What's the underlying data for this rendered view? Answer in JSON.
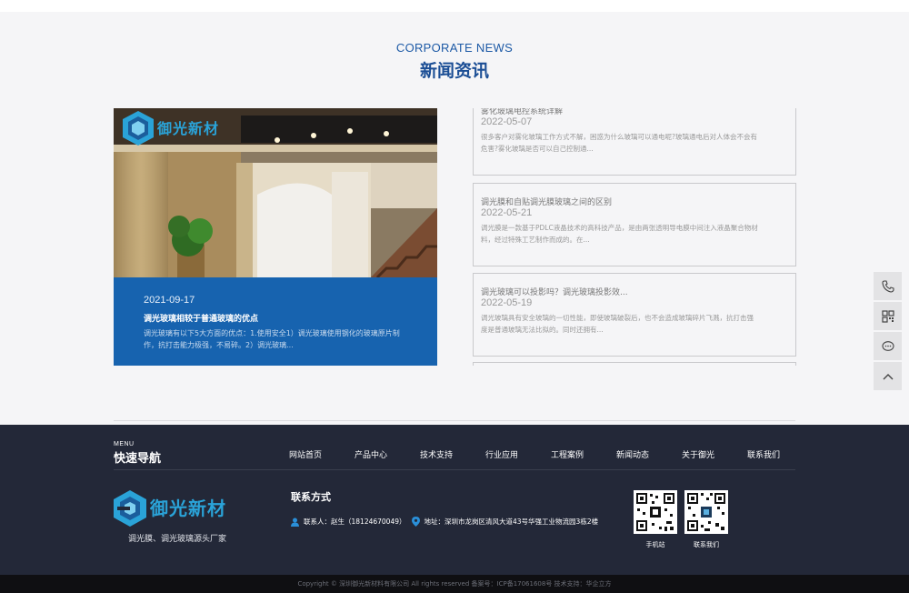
{
  "section": {
    "title_en": "CORPORATE NEWS",
    "title_zh": "新闻资讯"
  },
  "feature": {
    "date": "2021-09-17",
    "title": "调光玻璃相较于普通玻璃的优点",
    "desc": "调光玻璃有以下5大方面的优点：1.使用安全1）调光玻璃使用钢化的玻璃原片制作，抗打击能力极强，不易碎。2）调光玻璃...",
    "image_logo_text": "御光新材"
  },
  "news": [
    {
      "title": "雾化玻璃电控系统详解",
      "date": "2022-05-07",
      "desc": "很多客户对雾化玻璃工作方式不解，困惑为什么玻璃可以通电呢?玻璃通电后对人体会不会有危害?雾化玻璃是否可以自己控制通..."
    },
    {
      "title": "调光膜和自贴调光膜玻璃之间的区别",
      "date": "2022-05-21",
      "desc": "调光膜是一款基于PDLC液晶技术的高科技产品，是由两张透明导电膜中间注入液晶聚合物材料，经过特殊工艺制作而成的。在..."
    },
    {
      "title": "调光玻璃可以投影吗？调光玻璃投影效...",
      "date": "2022-05-19",
      "desc": "调光玻璃具有安全玻璃的一切性能，即使玻璃破裂后，也不会造成玻璃碎片飞溅，抗打击强度是普通玻璃无法比拟的。同时还拥有..."
    }
  ],
  "side_tools": [
    "phone-icon",
    "qrcode-icon",
    "chat-icon",
    "back-to-top-icon"
  ],
  "footer": {
    "menu_en": "MENU",
    "menu_zh": "快速导航",
    "nav": [
      "网站首页",
      "产品中心",
      "技术支持",
      "行业应用",
      "工程案例",
      "新闻动态",
      "关于御光",
      "联系我们"
    ],
    "logo_text": "御光新材",
    "slogan": "调光膜、调光玻璃源头厂家",
    "contact_title": "联系方式",
    "contact_person": "联系人：赵生（18124670049）",
    "contact_address": "地址：深圳市龙岗区清风大道43号华强工业物流园3栋2楼",
    "qr1_label": "手机站",
    "qr2_label": "联系我们"
  },
  "copyright": "Copyright © 深圳御光新材料有限公司 All rights reserved 备案号：ICP备17061608号 技术支持：华企立方",
  "colors": {
    "accent": "#1763af",
    "title": "#1b4e95",
    "footer_bg": "#232838",
    "copyright_bg": "#0f0f12"
  }
}
